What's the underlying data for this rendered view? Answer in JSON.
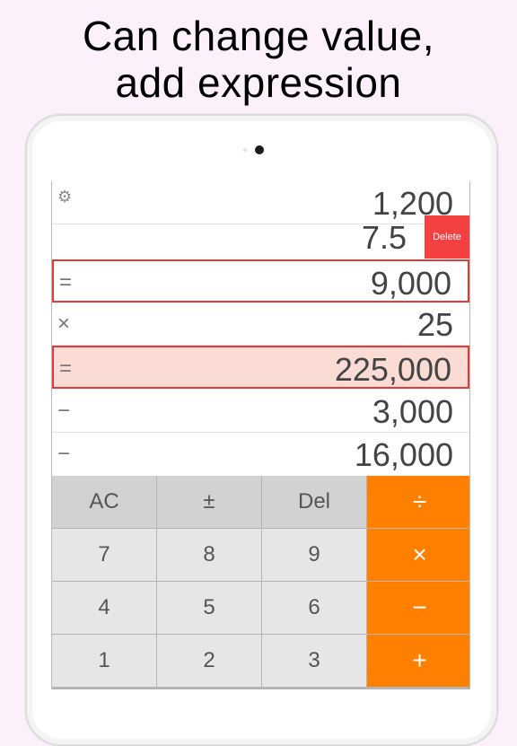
{
  "headline": {
    "line1": "Can change value,",
    "line2": "add expression"
  },
  "tape": {
    "rows": [
      {
        "op": "",
        "value": "1,200"
      },
      {
        "op": "",
        "value": "7.5",
        "action": "Delete"
      },
      {
        "op": "=",
        "value": "9,000"
      },
      {
        "op": "×",
        "value": "25"
      },
      {
        "op": "=",
        "value": "225,000"
      },
      {
        "op": "−",
        "value": "3,000"
      },
      {
        "op": "−",
        "value": "16,000"
      }
    ],
    "settings_icon": "gear-icon"
  },
  "keypad": {
    "row1": [
      "AC",
      "±",
      "Del",
      "÷"
    ],
    "row2": [
      "7",
      "8",
      "9",
      "×"
    ],
    "row3": [
      "4",
      "5",
      "6",
      "−"
    ],
    "row4": [
      "1",
      "2",
      "3",
      "+"
    ]
  },
  "colors": {
    "accent": "#ff7f00",
    "delete": "#f44040",
    "highlight": "#fbdcd5",
    "result_border": "#e53935"
  }
}
